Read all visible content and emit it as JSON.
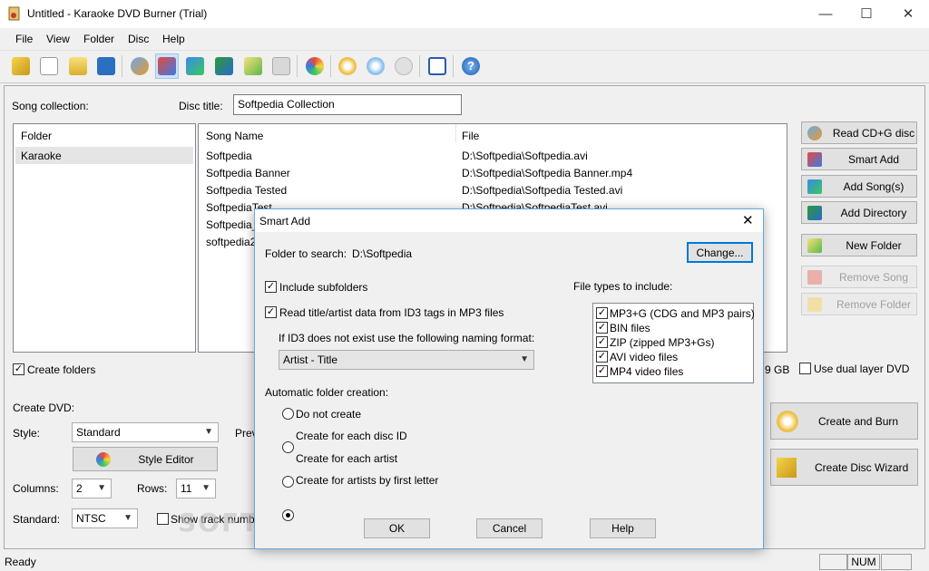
{
  "window": {
    "title": "Untitled - Karaoke DVD Burner (Trial)"
  },
  "menu": [
    "File",
    "View",
    "Folder",
    "Disc",
    "Help"
  ],
  "toolbar_icons": [
    "new-wizard-icon",
    "new-icon",
    "open-icon",
    "save-icon",
    "read-cd-icon",
    "smart-add-icon",
    "add-songs-icon",
    "add-directory-icon",
    "new-folder-icon",
    "remove-icon",
    "style-editor-icon",
    "burn-icon",
    "preview-icon",
    "forward-icon",
    "checklist-icon",
    "help-icon"
  ],
  "song_collection_label": "Song collection:",
  "disc_title_label": "Disc title:",
  "disc_title_value": "Softpedia Collection",
  "folder_list": {
    "header": "Folder",
    "items": [
      "Karaoke"
    ]
  },
  "song_list": {
    "col_name": "Song Name",
    "col_file": "File",
    "rows": [
      {
        "name": "Softpedia",
        "file": "D:\\Softpedia\\Softpedia.avi"
      },
      {
        "name": "Softpedia Banner",
        "file": "D:\\Softpedia\\Softpedia Banner.mp4"
      },
      {
        "name": "Softpedia Tested",
        "file": "D:\\Softpedia\\Softpedia Tested.avi"
      },
      {
        "name": "SoftpediaTest",
        "file": "D:\\Softpedia\\SoftpediaTest.avi"
      },
      {
        "name": "Softpedia_",
        "file": ""
      },
      {
        "name": "softpedia2",
        "file": ""
      }
    ]
  },
  "side_buttons": {
    "read_cd": "Read CD+G disc",
    "smart_add": "Smart Add",
    "add_songs": "Add Song(s)",
    "add_directory": "Add Directory",
    "new_folder": "New Folder",
    "remove_song": "Remove Song",
    "remove_folder": "Remove Folder"
  },
  "create_folders_label": "Create folders",
  "size_suffix": "9 GB",
  "dual_layer_label": "Use dual layer DVD",
  "create_dvd": {
    "heading": "Create DVD:",
    "style_label": "Style:",
    "style_value": "Standard",
    "preview_partial": "Prev",
    "style_editor": "Style Editor",
    "columns_label": "Columns:",
    "columns_value": "2",
    "rows_label": "Rows:",
    "rows_value": "11",
    "standard_label": "Standard:",
    "standard_value": "NTSC",
    "show_track_label": "Show track number"
  },
  "burn_buttons": {
    "create_burn": "Create and Burn",
    "wizard": "Create Disc Wizard"
  },
  "status": {
    "text": "Ready",
    "num": "NUM"
  },
  "watermark": "SOFTPEDIA",
  "dialog": {
    "title": "Smart Add",
    "folder_label": "Folder to search:",
    "folder_value": "D:\\Softpedia",
    "change_button": "Change...",
    "include_subfolders": "Include subfolders",
    "read_id3": "Read title/artist data from ID3 tags in MP3 files",
    "naming_label": "If ID3 does not exist use the following naming format:",
    "naming_value": "Artist - Title",
    "auto_folder_label": "Automatic folder creation:",
    "radio_options": [
      "Do not create",
      "Create for each disc ID",
      "Create for each artist",
      "Create for artists by first letter"
    ],
    "selected_radio": 3,
    "file_types_label": "File types to include:",
    "file_types": [
      "MP3+G (CDG and MP3 pairs)",
      "BIN files",
      "ZIP (zipped MP3+Gs)",
      "AVI video files",
      "MP4 video files"
    ],
    "ok": "OK",
    "cancel": "Cancel",
    "help": "Help"
  }
}
